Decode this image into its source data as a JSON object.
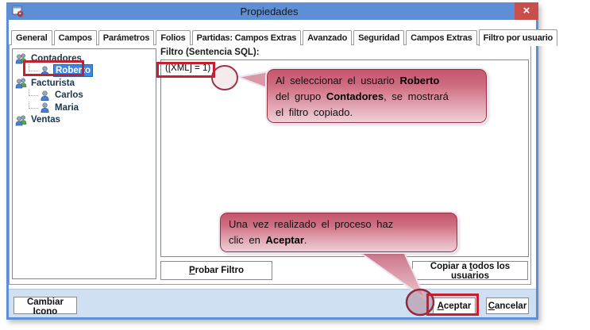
{
  "window": {
    "title": "Propiedades",
    "close_glyph": "×"
  },
  "tabs": [
    {
      "label": "General"
    },
    {
      "label": "Campos"
    },
    {
      "label": "Parámetros"
    },
    {
      "label": "Folios"
    },
    {
      "label": "Partidas: Campos Extras"
    },
    {
      "label": "Avanzado"
    },
    {
      "label": "Seguridad"
    },
    {
      "label": "Campos Extras"
    },
    {
      "label": "Filtro por usuario"
    }
  ],
  "tree": {
    "items": [
      {
        "label": "Contadores",
        "type": "group",
        "level": 0,
        "selected": false
      },
      {
        "label": "Roberto",
        "type": "user",
        "level": 1,
        "selected": true
      },
      {
        "label": "Facturista",
        "type": "group",
        "level": 0,
        "selected": false
      },
      {
        "label": "Carlos",
        "type": "user",
        "level": 1,
        "selected": false
      },
      {
        "label": "Maria",
        "type": "user",
        "level": 1,
        "selected": false
      },
      {
        "label": "Ventas",
        "type": "group",
        "level": 0,
        "selected": false
      }
    ]
  },
  "filter": {
    "label": "Filtro (Sentencia SQL):",
    "value": "([XML] = 1)"
  },
  "buttons": {
    "probar": {
      "pre": "",
      "key": "P",
      "post": "robar Filtro"
    },
    "copiar": {
      "pre": "Copiar a ",
      "key": "t",
      "post": "odos los usuarios"
    },
    "cambiar": {
      "label": "Cambiar Icono"
    },
    "aceptar": {
      "pre": "",
      "key": "A",
      "post": "ceptar"
    },
    "cancelar": {
      "pre": "",
      "key": "C",
      "post": "ancelar"
    }
  },
  "callouts": {
    "c1": {
      "lines": [
        [
          {
            "t": "Al seleccionar el usuario "
          },
          {
            "t": "Roberto",
            "b": true
          }
        ],
        [
          {
            "t": "del grupo "
          },
          {
            "t": "Contadores",
            "b": true
          },
          {
            "t": ", se mostrará"
          }
        ],
        [
          {
            "t": "el filtro copiado."
          }
        ]
      ]
    },
    "c2": {
      "lines": [
        [
          {
            "t": "Una vez realizado el proceso haz"
          }
        ],
        [
          {
            "t": "clic en "
          },
          {
            "t": "Aceptar",
            "b": true
          },
          {
            "t": "."
          }
        ]
      ]
    }
  },
  "colors": {
    "titlebar_blue": "#5e8ed5",
    "close_red": "#c9504a",
    "bottom_bar_blue": "#cfe0f3",
    "annotation_red": "#c6202e",
    "callout_dark": "#c4566c",
    "callout_light": "#eed0d6",
    "tree_selection_blue": "#3b87dd"
  }
}
